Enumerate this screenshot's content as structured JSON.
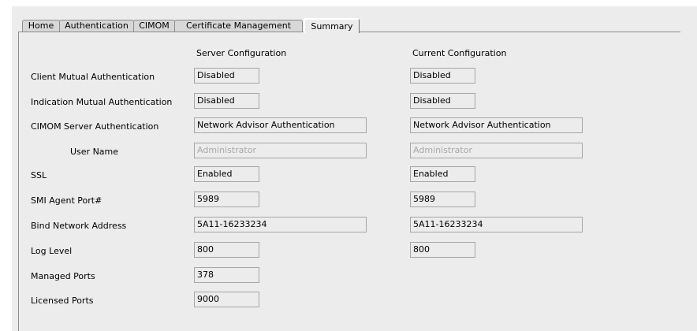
{
  "tabs": [
    {
      "label": "Home"
    },
    {
      "label": "Authentication"
    },
    {
      "label": "CIMOM"
    },
    {
      "label": "Certificate Management"
    },
    {
      "label": "Summary",
      "active": true
    }
  ],
  "headers": {
    "server": "Server Configuration",
    "current": "Current Configuration"
  },
  "rows": {
    "client_mutual_auth": {
      "label": "Client Mutual Authentication",
      "server": "Disabled",
      "current": "Disabled"
    },
    "indication_mutual_auth": {
      "label": "Indication Mutual Authentication",
      "server": "Disabled",
      "current": "Disabled"
    },
    "cimom_server_auth": {
      "label": "CIMOM Server Authentication",
      "server": "Network Advisor Authentication",
      "current": "Network Advisor Authentication"
    },
    "user_name": {
      "label": "User Name",
      "server": "Administrator",
      "current": "Administrator"
    },
    "ssl": {
      "label": "SSL",
      "server": "Enabled",
      "current": "Enabled"
    },
    "smi_agent_port": {
      "label": "SMI Agent Port#",
      "server": "5989",
      "current": "5989"
    },
    "bind_network_address": {
      "label": "Bind Network Address",
      "server": "5A11-16233234",
      "current": "5A11-16233234"
    },
    "log_level": {
      "label": "Log Level",
      "server": "800",
      "current": "800"
    },
    "managed_ports": {
      "label": "Managed Ports",
      "server": "378"
    },
    "licensed_ports": {
      "label": "Licensed Ports",
      "server": "9000"
    }
  }
}
